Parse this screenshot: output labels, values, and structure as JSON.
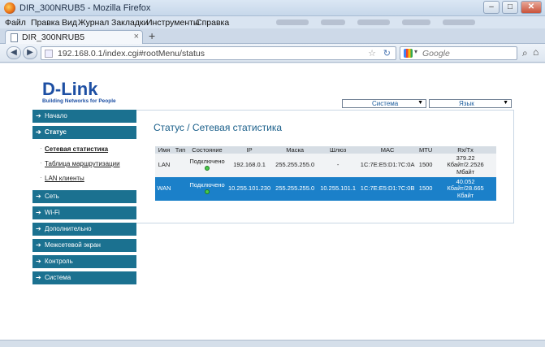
{
  "window": {
    "title": "DIR_300NRUB5 - Mozilla Firefox",
    "controls": {
      "minimize": "–",
      "maximize": "□",
      "close": "✕"
    }
  },
  "menubar": [
    "Файл",
    "Правка",
    "Вид",
    "Журнал",
    "Закладки",
    "Инструменты",
    "Справка"
  ],
  "tab": {
    "label": "DIR_300NRUB5",
    "close": "×",
    "new": "+"
  },
  "nav": {
    "url": "192.168.0.1/index.cgi#rootMenu/status",
    "search_placeholder": "Google"
  },
  "router": {
    "brand": "D-Link",
    "tagline": "Building Networks for People",
    "top_selects": {
      "system": "Система",
      "language": "Язык"
    },
    "sidebar": [
      {
        "label": "Начало",
        "active": false
      },
      {
        "label": "Статус",
        "active": true,
        "children": [
          {
            "label": "Сетевая статистика",
            "active": true
          },
          {
            "label": "Таблица маршрутизации",
            "active": false
          },
          {
            "label": "LAN клиенты",
            "active": false
          }
        ]
      },
      {
        "label": "Сеть",
        "active": false
      },
      {
        "label": "Wi-Fi",
        "active": false
      },
      {
        "label": "Дополнительно",
        "active": false
      },
      {
        "label": "Межсетевой экран",
        "active": false
      },
      {
        "label": "Контроль",
        "active": false
      },
      {
        "label": "Система",
        "active": false
      }
    ],
    "page_title": "Статус  / Сетевая статистика",
    "table": {
      "headers": [
        "Имя",
        "Тип",
        "Состояние",
        "IP",
        "Маска",
        "Шлюз",
        "MAC",
        "MTU",
        "Rx/Tx"
      ],
      "rows": [
        {
          "name": "LAN",
          "type": "",
          "state": "Подключено",
          "ip": "192.168.0.1",
          "mask": "255.255.255.0",
          "gateway": "-",
          "mac": "1C:7E:E5:D1:7C:0A",
          "mtu": "1500",
          "rxtx": [
            "379.22",
            "Кбайт/2.2526",
            "Мбайт"
          ]
        },
        {
          "name": "WAN",
          "type": "",
          "state": "Подключено",
          "ip": "10.255.101.230",
          "mask": "255.255.255.0",
          "gateway": "10.255.101.1",
          "mac": "1C:7E:E5:D1:7C:0B",
          "mtu": "1500",
          "rxtx": [
            "40.052",
            "Кбайт/28.665",
            "Кбайт"
          ]
        }
      ]
    }
  }
}
